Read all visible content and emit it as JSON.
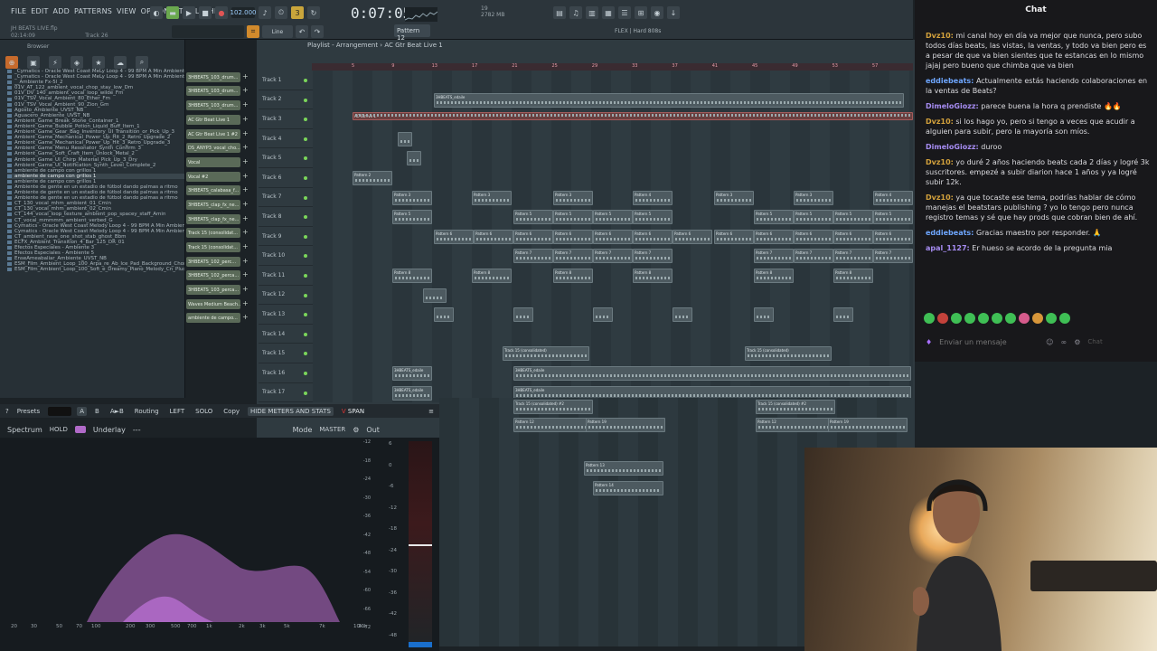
{
  "menu": [
    "FILE",
    "EDIT",
    "ADD",
    "PATTERNS",
    "VIEW",
    "OPTIONS",
    "TOOLS",
    "HELP"
  ],
  "song": {
    "name": "JH BEATS LIVE.flp",
    "position": "02:14:09",
    "track": "Track 26"
  },
  "transport": {
    "bpm": "102.000",
    "time": "0:07:05",
    "mem": "2782 MB",
    "cpu_label": "19"
  },
  "tools": {
    "pattern": "Pattern 12",
    "line_mode": "Line",
    "flex": "FLEX | Hard 808s"
  },
  "browser": {
    "title": "Browser",
    "items": [
      "_Cymatics - Oracle West Coast MeLy Loop 4 - 99 BPM A Min Ambient Pad",
      "_Cymatics - Oracle West Coast MeLy Loop 4 - 99 BPM A Min Ambient Pad",
      "__Ambiente Fx-5l_2",
      "01V_AT_122_ambient_vocal_chop_stay_low_Dm",
      "01V_DV_140_ambient_vocal_loop_wilde_Fm",
      "01V_TSV_Vocal_Ambient_80_Ether_Fm",
      "01V_TSV_Vocal_Ambient_90_Zion_Gm",
      "Agosto_Ambiente_UVST_NB",
      "Aguacero_Ambiente_UVST_NB",
      "Ambient_Game_Break_Stone_Container_1",
      "Ambient_Game_Bubble_Potion_Liquid_Buff_Item_1",
      "Ambient_Game_Gear_Bag_Inventory_UI_Transition_or_Pick_Up_3",
      "Ambient_Game_Mechanical_Power_Up_Hit_2_Retro_Upgrade_2",
      "Ambient_Game_Mechanical_Power_Up_Hit_3_Retro_Upgrade_3",
      "Ambient_Game_Menu_Resonator_Synth_Confirm_3",
      "Ambient_Game_Soft_Craft_Item_Unlock_Metal_2",
      "Ambient_Game_UI_Chirp_Material_Pick_Up_3_Dry",
      "Ambient_Game_UI_Notification_Synth_Level_Complete_2",
      "ambiente de campo con grillos 1",
      "ambiente de campo con grillos 1",
      "ambiente de campo con grillos 1",
      "Ambiente de gente en un estadio de fútbol dando palmas a ritmo",
      "Ambiente de gente en un estadio de fútbol dando palmas a ritmo",
      "Ambiente de gente en un estadio de fútbol dando palmas a ritmo",
      "CT_130_vocal_mhm_ambient_01_Cmin",
      "CT_130_vocal_mhm_ambient_02_Cmin",
      "CT_144_vocal_loop_texture_ambient_pop_spacey_staff_Amin",
      "CT_vocal_mmmmm_ambient_verbed_G",
      "Cymatics - Oracle West Coast Melody Loop 4 - 99 BPM A Min Ambient Pad",
      "Cymatics - Oracle West Coast Melody Loop 4 - 99 BPM A Min Ambient Pad",
      "CT_ambient_rave_one_shot_stab_ghost_Bbm",
      "ECFX_Ambient_Transition_4_Bar_125_DR_01",
      "Efectos Especiales - Ambiente 3",
      "Efectos Especiales - Ambiente 5",
      "EnseAmeabaliar_Ambiente_UVST_NB",
      "ESM_Film_Ambient_Loop_100_Arpa_re_Ab_Ice_Pad_Background_Chord",
      "ESM_Film_Ambient_Loop_100_Soft_e_Dreamy_Piano_Melody_Cn_Pluck"
    ]
  },
  "channels": [
    "3HBEATS_103_drum...",
    "3HBEATS_103_drum...",
    "3HBEATS_103_drum...",
    "AC Gtr Beat Live 1",
    "AC Gtr Beat Live 1 #2",
    "DS_ANYP3_vocal_cho...",
    "Vocal",
    "Vocal #2",
    "3HBEATS_calabasa_f...",
    "3HBEATS_clap_fx_ne...",
    "3HBEATS_clap_fx_ne...",
    "Track 15 (consolidat...",
    "Track 15 (consolidat...",
    "3HBEATS_102_perc...",
    "3HBEATS_102_perca...",
    "3HBEATS_103_perca...",
    "Waves Medium Beach...",
    "ambiente de campo..."
  ],
  "playlist": {
    "title": "Playlist - Arrangement",
    "crumb": "AC Gtr Beat Live 1",
    "ruler": [
      "5",
      "9",
      "13",
      "17",
      "21",
      "25",
      "29",
      "33",
      "37",
      "41",
      "45",
      "49",
      "53",
      "57"
    ],
    "tracks": [
      "Track 1",
      "Track 2",
      "Track 3",
      "Track 4",
      "Track 5",
      "Track 6",
      "Track 7",
      "Track 8",
      "Track 9",
      "Track 10",
      "Track 11",
      "Track 12",
      "Track 13",
      "Track 14",
      "Track 15",
      "Track 16",
      "Track 17"
    ],
    "clip_labels": {
      "p2": "Pattern 2",
      "p3": "Pattern 3",
      "p4": "Pattern 4",
      "p5": "Pattern 5",
      "p6": "Pattern 6",
      "p7": "Pattern 7",
      "p8": "Pattern 8",
      "p12": "Pattern 12",
      "p13": "Pattern 13",
      "p14": "Pattern 14",
      "p19": "Pattern 19",
      "t15": "Track 15 (consolidated)",
      "t15b": "Track 15 (consolidated) #2",
      "beat": "3HBEATS_edaile",
      "gtr": "AC Gtr..ve 1"
    }
  },
  "span": {
    "toolbar": {
      "presets": "Presets",
      "a": "A",
      "b": "B",
      "ab": "A►B",
      "routing": "Routing",
      "left": "LEFT",
      "solo": "SOLO",
      "copy": "Copy",
      "hide": "HIDE METERS AND STATS",
      "brand": "SPAN"
    },
    "head": {
      "spectrum": "Spectrum",
      "hold": "HOLD",
      "underlay": "Underlay",
      "dash": "---",
      "mode": "Mode",
      "master": "MASTER",
      "out": "Out"
    },
    "freq_ticks": [
      "20",
      "30",
      "50",
      "70",
      "100",
      "200",
      "300",
      "500",
      "700",
      "1k",
      "2k",
      "3k",
      "5k",
      "7k",
      "10k",
      "20k"
    ],
    "db_ticks": [
      "-12",
      "-18",
      "-24",
      "-30",
      "-36",
      "-42",
      "-48",
      "-54",
      "-60",
      "-66",
      "-72"
    ],
    "meter_ticks": [
      "6",
      "0",
      "-6",
      "-12",
      "-18",
      "-24",
      "-30",
      "-36",
      "-42",
      "-48"
    ]
  },
  "chat": {
    "title": "Chat",
    "messages": [
      {
        "user": "",
        "text": "mi canal hoy en día va mejor que nunca, pero subo todos días beats, las vistas, la ventas, y todo va bien pero es a pesar de que va bien sientes que te estancas en lo mismo jajaj pero bueno que chimba que va bien",
        "user_label": "Dvz10:"
      },
      {
        "user_label": "eddiebeats:",
        "text": "Actualmente estás haciendo colaboraciones en la ventas de Beats?"
      },
      {
        "user_label": "DimeloGiozz:",
        "text": "parece buena la hora q prendiste 🔥🔥"
      },
      {
        "user_label": "Dvz10:",
        "text": "si los hago yo, pero si tengo a veces que acudir a alguien para subir, pero la mayoría son míos."
      },
      {
        "user_label": "DimeloGiozz:",
        "text": "duroo"
      },
      {
        "user_label": "Dvz10:",
        "text": "yo duré 2 años haciendo beats cada 2 días y logré 3k suscritores. empezé a subir diarion hace 1 años y ya logré subir 12k."
      },
      {
        "user_label": "Dvz10:",
        "text": "ya que tocaste ese tema, podrías hablar de cómo manejas el beatstars publishing ? yo lo tengo pero nunca registro temas y sé que hay prods que cobran bien de ahí."
      },
      {
        "user_label": "eddiebeats:",
        "text": "Gracias maestro por responder. 🙏"
      },
      {
        "user_label": "apal_1127:",
        "text": "Er hueso se acordo de la pregunta mia"
      }
    ],
    "input_placeholder": "Enviar un mensaje",
    "chat_button": "Chat"
  },
  "colors": {
    "accent_green": "#7bd65a",
    "playlist_ruler": "#e39aa6",
    "spectrum": "#b06ac8",
    "chat_bg": "#18181b"
  }
}
